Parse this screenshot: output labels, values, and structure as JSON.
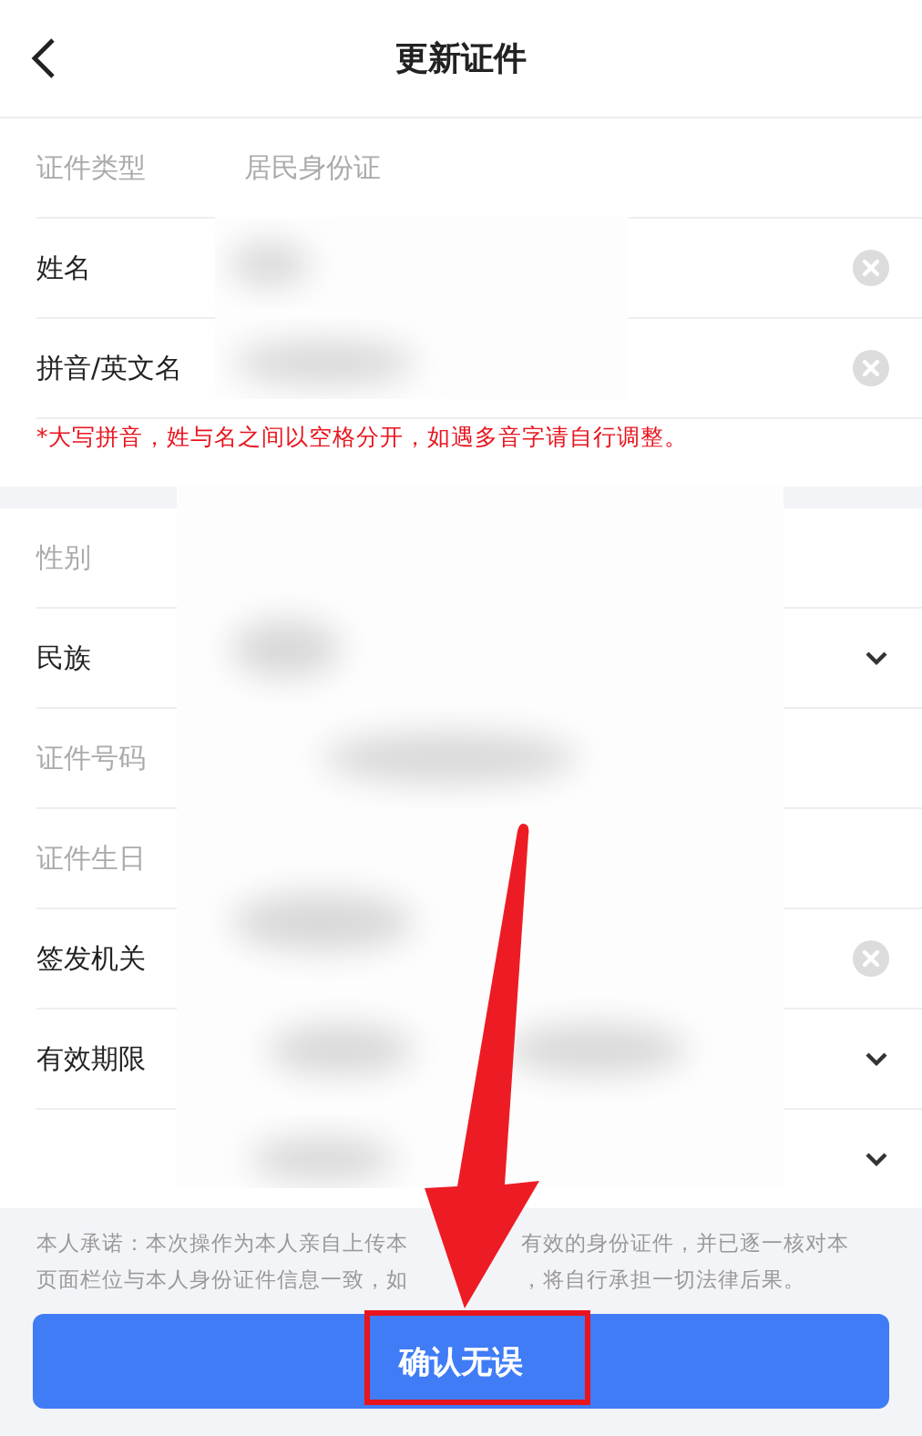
{
  "header": {
    "title": "更新证件"
  },
  "section_1": {
    "rows": [
      {
        "label": "证件类型",
        "value": "居民身份证",
        "kind": "readonly"
      },
      {
        "label": "姓名",
        "kind": "clear"
      },
      {
        "label": "拼音/英文名",
        "kind": "clear"
      }
    ],
    "hint": "*大写拼音，姓与名之间以空格分开，如遇多音字请自行调整。"
  },
  "section_2": {
    "rows": [
      {
        "label": "性别",
        "kind": "readonly"
      },
      {
        "label": "民族",
        "kind": "select"
      },
      {
        "label": "证件号码",
        "kind": "readonly"
      },
      {
        "label": "证件生日",
        "kind": "readonly"
      },
      {
        "label": "签发机关",
        "kind": "clear"
      },
      {
        "label": "有效期限",
        "kind": "select"
      },
      {
        "kind": "select"
      }
    ]
  },
  "promise": {
    "lines": [
      [
        "本人承诺：本次操作为本人亲自上传本",
        "有效的身份证件，并已逐一核对本"
      ],
      [
        "页面栏位与本人身份证件信息一致，如",
        "，将自行承担一切法律后果。"
      ]
    ]
  },
  "confirm_button": {
    "label": "确认无误"
  }
}
